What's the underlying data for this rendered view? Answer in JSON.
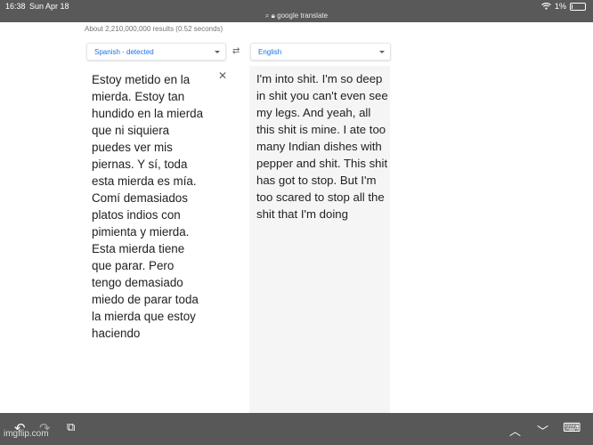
{
  "status_bar": {
    "time": "16:38",
    "date": "Sun Apr 18",
    "url": "google translate",
    "battery": "1%"
  },
  "results_info": "About 2,210,000,000 results (0.52 seconds)",
  "source_language": "Spanish - detected",
  "target_language": "English",
  "source_text": "Estoy metido en la mierda. Estoy tan hundido en la mierda que ni siquiera puedes ver mis piernas. Y sí, toda esta mierda es mía. Comí demasiados platos indios con pimienta y mierda. Esta mierda tiene que parar. Pero tengo demasiado miedo de parar toda la mierda que estoy haciendo",
  "translated_text": "I'm into shit. I'm so deep in shit you can't even see my legs. And yeah, all this shit is mine. I ate too many Indian dishes with pepper and shit. This shit has got to stop. But I'm too scared to stop all the shit that I'm doing",
  "watermark": "imgflip.com",
  "icons": {
    "undo": "undo-icon",
    "redo": "redo-icon",
    "paste": "clipboard-icon",
    "up": "chevron-up-icon",
    "down": "chevron-down-icon",
    "keyboard": "keyboard-icon",
    "wifi": "wifi-icon",
    "lock": "lock-icon",
    "swap": "swap-icon",
    "clear": "close-icon"
  },
  "colors": {
    "accent": "#1a73e8",
    "toolbar": "#585858",
    "status_bar": "#595959",
    "target_pane": "#f5f5f5"
  }
}
